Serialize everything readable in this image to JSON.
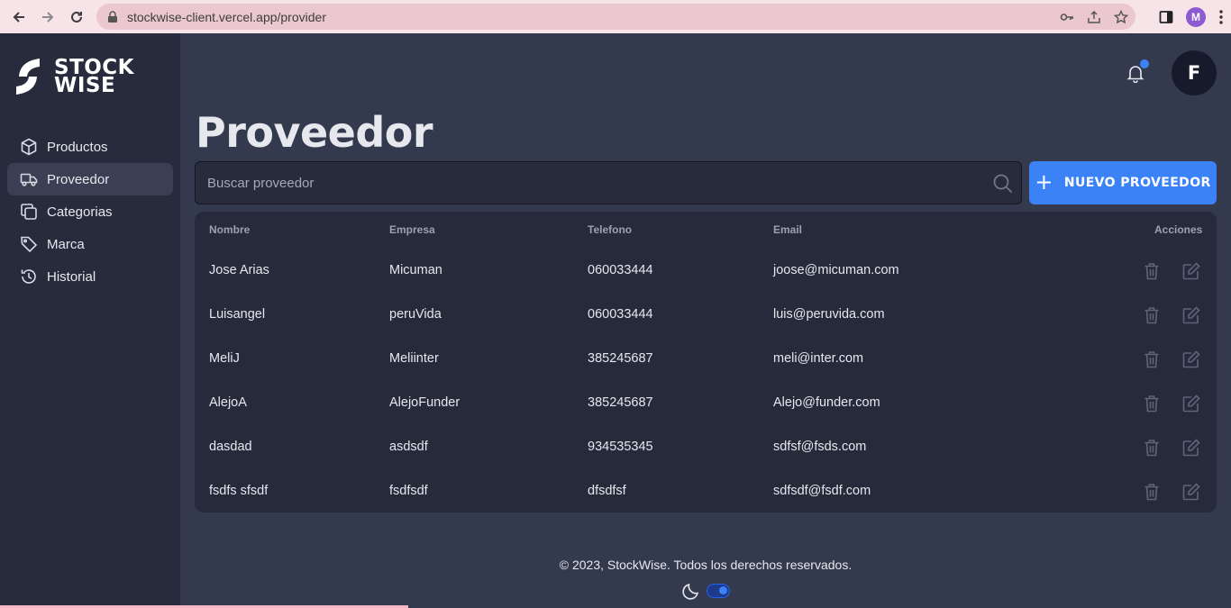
{
  "browser": {
    "url": "stockwise-client.vercel.app/provider",
    "profile_initial": "M"
  },
  "app": {
    "logo_line1": "STOCK",
    "logo_line2": "WISE",
    "avatar_initial": "F"
  },
  "sidebar": {
    "items": [
      {
        "label": "Productos",
        "icon": "box-icon",
        "active": false
      },
      {
        "label": "Proveedor",
        "icon": "truck-icon",
        "active": true
      },
      {
        "label": "Categorias",
        "icon": "copy-icon",
        "active": false
      },
      {
        "label": "Marca",
        "icon": "tag-icon",
        "active": false
      },
      {
        "label": "Historial",
        "icon": "history-icon",
        "active": false
      }
    ]
  },
  "page": {
    "title": "Proveedor",
    "search_placeholder": "Buscar proveedor",
    "new_button_label": "NUEVO PROVEEDOR"
  },
  "table": {
    "headers": [
      "Nombre",
      "Empresa",
      "Telefono",
      "Email",
      "Acciones"
    ],
    "rows": [
      {
        "nombre": "Jose Arias",
        "empresa": "Micuman",
        "telefono": "060033444",
        "email": "joose@micuman.com"
      },
      {
        "nombre": "Luisangel",
        "empresa": "peruVida",
        "telefono": "060033444",
        "email": "luis@peruvida.com"
      },
      {
        "nombre": "MeliJ",
        "empresa": "Meliinter",
        "telefono": "385245687",
        "email": "meli@inter.com"
      },
      {
        "nombre": "AlejoA",
        "empresa": "AlejoFunder",
        "telefono": "385245687",
        "email": "Alejo@funder.com"
      },
      {
        "nombre": "dasdad",
        "empresa": "asdsdf",
        "telefono": "934535345",
        "email": "sdfsf@fsds.com"
      },
      {
        "nombre": "fsdfs sfsdf",
        "empresa": "fsdfsdf",
        "telefono": "dfsdfsf",
        "email": "sdfsdf@fsdf.com"
      }
    ]
  },
  "footer": {
    "text": "© 2023, StockWise. Todos los derechos reservados.",
    "dark_mode_on": true
  },
  "colors": {
    "accent": "#3b82f6",
    "sidebar_bg": "#272b3c",
    "main_bg": "#343a4e"
  }
}
